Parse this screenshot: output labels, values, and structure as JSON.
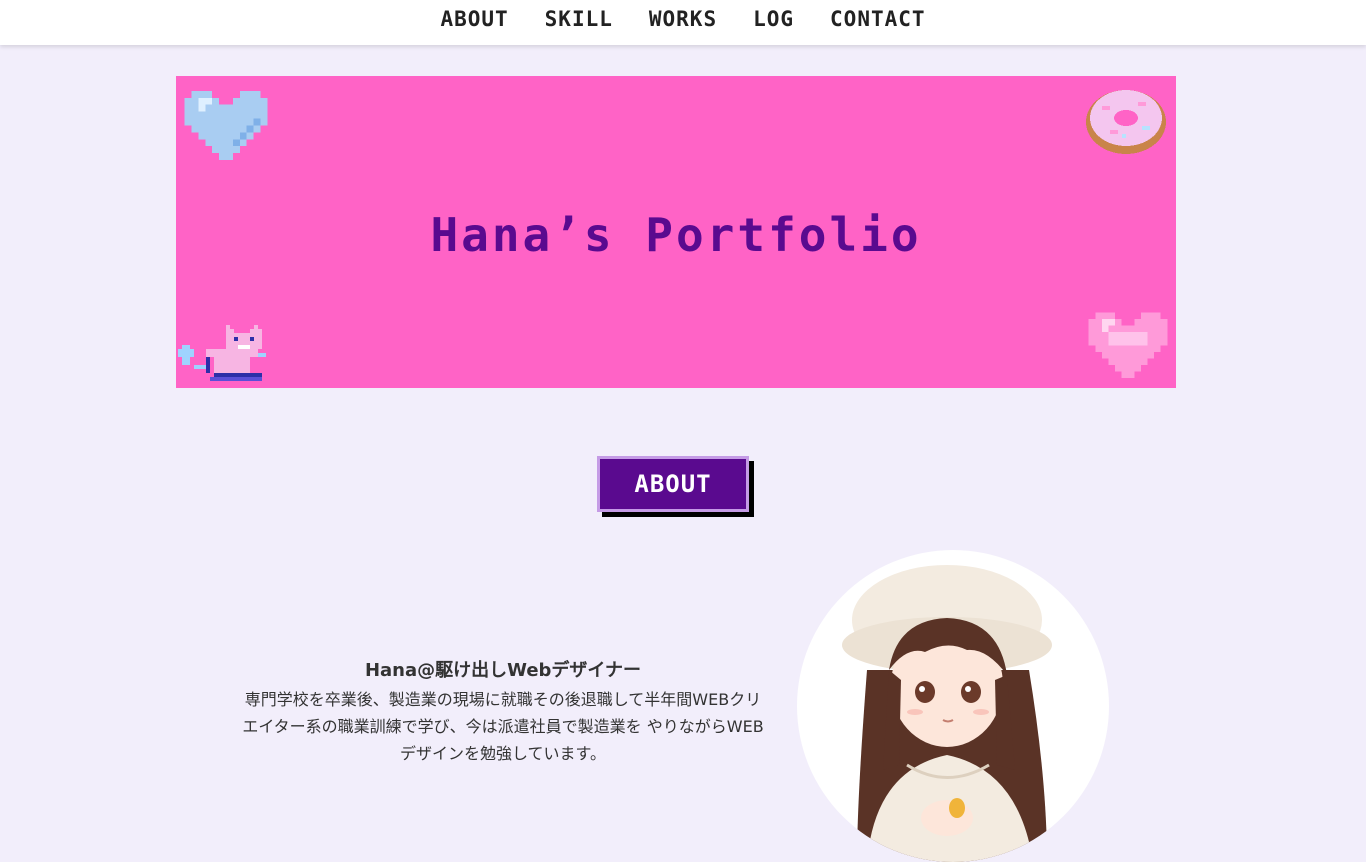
{
  "nav": {
    "items": [
      {
        "label": "ABOUT"
      },
      {
        "label": "SKILL"
      },
      {
        "label": "WORKS"
      },
      {
        "label": "LOG"
      },
      {
        "label": "CONTACT"
      }
    ]
  },
  "hero": {
    "title": "Hana’s Portfolio",
    "background_color": "#ff63c6",
    "title_color": "#5a0a8f",
    "decorations": [
      "heart-icon-blue",
      "donut-icon",
      "cat-icon",
      "heart-icon-pink"
    ]
  },
  "about": {
    "button_label": "ABOUT",
    "name": "Hana@駆け出しWebデザイナー",
    "description": "専門学校を卒業後、製造業の現場に就職その後退職して半年間WEBクリエイター系の職業訓練で学び、今は派遣社員で製造業を やりながらWEBデザインを勉強しています。",
    "accent_color": "#5a0a8f"
  }
}
